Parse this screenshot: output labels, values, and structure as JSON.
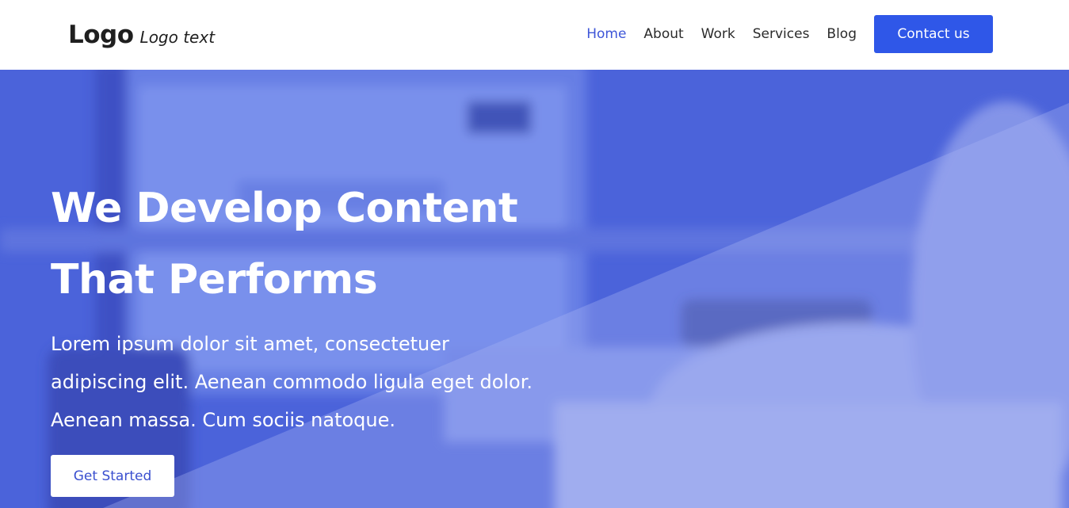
{
  "brand": {
    "logo": "Logo",
    "tagline": "Logo text"
  },
  "nav": {
    "items": [
      {
        "label": "Home",
        "active": true
      },
      {
        "label": "About",
        "active": false
      },
      {
        "label": "Work",
        "active": false
      },
      {
        "label": "Services",
        "active": false
      },
      {
        "label": "Blog",
        "active": false
      }
    ],
    "cta_label": "Contact us"
  },
  "hero": {
    "title_line1": "We Develop Content",
    "title_line2": "That Performs",
    "description": "Lorem ipsum dolor sit amet, consectetuer adipiscing elit. Aenean commodo ligula eget dolor. Aenean massa. Cum sociis natoque.",
    "button_label": "Get Started"
  },
  "colors": {
    "accent": "#2f57e8",
    "nav_active": "#3e56d8",
    "hero_overlay": "#4a64dc",
    "text_dark": "#1f1f1f"
  }
}
